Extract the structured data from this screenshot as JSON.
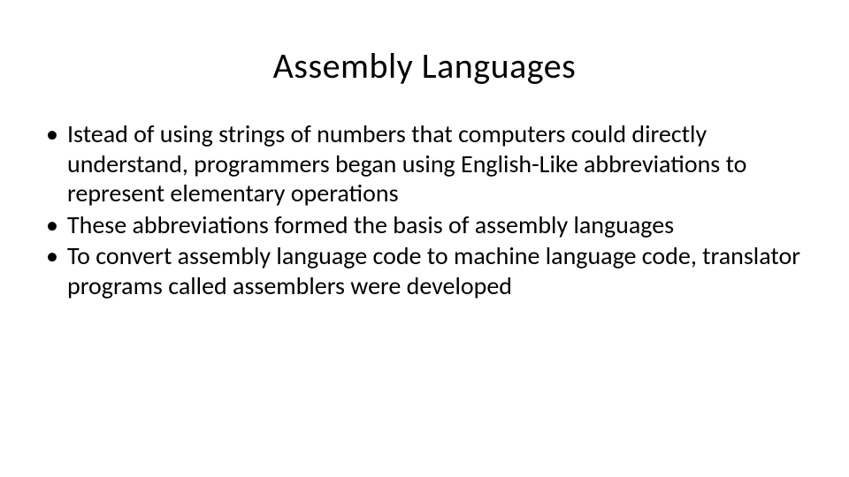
{
  "slide": {
    "title": "Assembly Languages",
    "bullets": [
      "Istead of using strings of numbers that computers could directly understand, programmers began using English-Like abbreviations to represent elementary operations",
      "These abbreviations formed the basis of assembly languages",
      "To convert assembly language code to machine language code, translator programs called assemblers were developed"
    ]
  }
}
